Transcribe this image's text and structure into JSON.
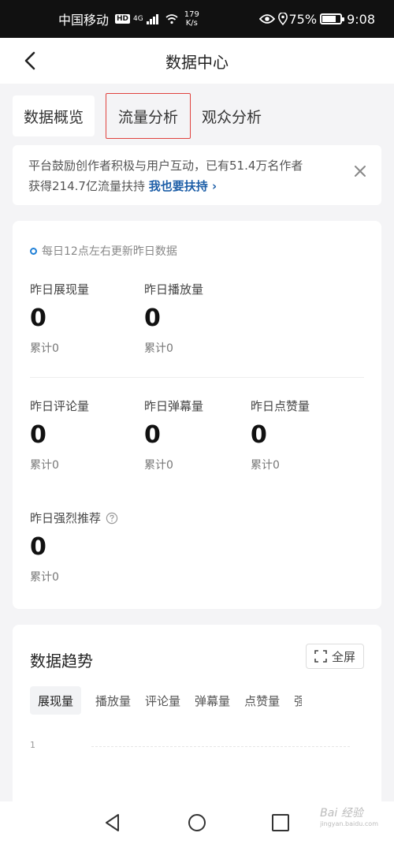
{
  "status_bar": {
    "carrier": "中国移动",
    "hd": "HD",
    "signal": "4G",
    "speed_value": "179",
    "speed_unit": "K/s",
    "battery_percent": "75%",
    "battery_level": 0.75,
    "time": "9:08"
  },
  "header": {
    "title": "数据中心"
  },
  "tabs": [
    {
      "label": "数据概览"
    },
    {
      "label": "流量分析"
    },
    {
      "label": "观众分析"
    }
  ],
  "notice": {
    "text_line1": "平台鼓励创作者积极与用户互动，已有51.4万名作者",
    "text_line2": "获得214.7亿流量扶持",
    "link": "我也要扶持 ›"
  },
  "stats": {
    "update_note": "每日12点左右更新昨日数据",
    "items": [
      {
        "label": "昨日展现量",
        "value": "0",
        "cumulative": "累计0"
      },
      {
        "label": "昨日播放量",
        "value": "0",
        "cumulative": "累计0"
      },
      {
        "label": "昨日评论量",
        "value": "0",
        "cumulative": "累计0"
      },
      {
        "label": "昨日弹幕量",
        "value": "0",
        "cumulative": "累计0"
      },
      {
        "label": "昨日点赞量",
        "value": "0",
        "cumulative": "累计0"
      },
      {
        "label": "昨日强烈推荐",
        "value": "0",
        "cumulative": "累计0"
      }
    ]
  },
  "trend": {
    "title": "数据趋势",
    "fullscreen": "全屏",
    "metric_tabs": [
      "展现量",
      "播放量",
      "评论量",
      "弹幕量",
      "点赞量",
      "强"
    ],
    "y_tick": "1"
  },
  "watermark": {
    "brand": "Bai 经验",
    "url": "jingyan.baidu.com"
  },
  "colors": {
    "accent": "#1e5fa8",
    "highlight_border": "#e0423f"
  }
}
